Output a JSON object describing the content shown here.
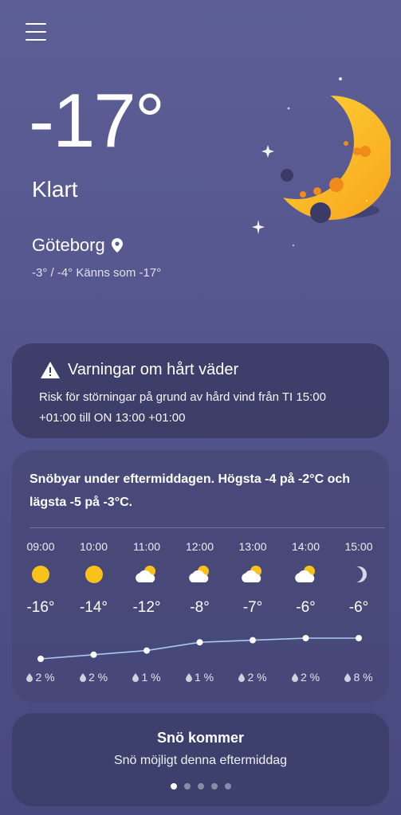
{
  "current": {
    "temperature": "-17°",
    "condition": "Klart",
    "location": "Göteborg",
    "minmax_feels": "-3° / -4° Känns som -17°",
    "weather_icon": "crescent-moon-icon"
  },
  "warning": {
    "title": "Varningar om hårt väder",
    "text": "Risk för störningar på grund av hård vind från TI 15:00 +01:00 till ON 13:00 +01:00"
  },
  "forecast": {
    "summary": "Snöbyar under eftermiddagen. Högsta -4 på -2°C och lägsta -5 på -3°C.",
    "hours": [
      {
        "time": "09:00",
        "icon": "sun-icon",
        "temp": "-16°",
        "temp_value": -16,
        "precip": "2 %"
      },
      {
        "time": "10:00",
        "icon": "sun-icon",
        "temp": "-14°",
        "temp_value": -14,
        "precip": "2 %"
      },
      {
        "time": "11:00",
        "icon": "partly-cloudy-icon",
        "temp": "-12°",
        "temp_value": -12,
        "precip": "1 %"
      },
      {
        "time": "12:00",
        "icon": "partly-cloudy-icon",
        "temp": "-8°",
        "temp_value": -8,
        "precip": "1 %"
      },
      {
        "time": "13:00",
        "icon": "partly-cloudy-icon",
        "temp": "-7°",
        "temp_value": -7,
        "precip": "2 %"
      },
      {
        "time": "14:00",
        "icon": "partly-cloudy-icon",
        "temp": "-6°",
        "temp_value": -6,
        "precip": "2 %"
      },
      {
        "time": "15:00",
        "icon": "moon-icon",
        "temp": "-6°",
        "temp_value": -6,
        "precip": "8 %"
      }
    ]
  },
  "snow": {
    "title": "Snö kommer",
    "subtitle": "Snö möjligt denna eftermiddag"
  },
  "pager": {
    "count": 5,
    "active": 0
  },
  "colors": {
    "sun": "#f9c21b",
    "moon": "#fbb01c",
    "line": "#a9c8f2"
  }
}
